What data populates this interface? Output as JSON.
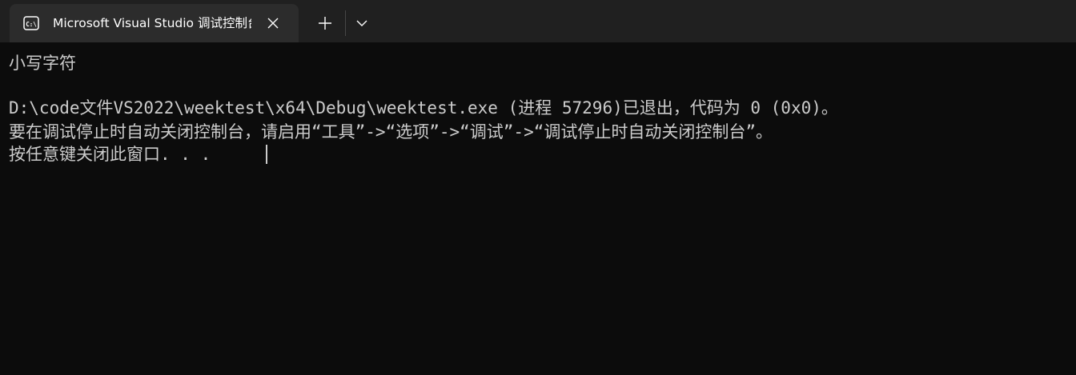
{
  "tab": {
    "title": "Microsoft Visual Studio 调试控制台",
    "icon": "console-icon"
  },
  "controls": {
    "new_tab_icon": "plus-icon",
    "dropdown_icon": "chevron-down-icon",
    "close_icon": "close-icon"
  },
  "console": {
    "lines": [
      "小写字符",
      "",
      "D:\\code文件VS2022\\weektest\\x64\\Debug\\weektest.exe (进程 57296)已退出，代码为 0 (0x0)。",
      "要在调试停止时自动关闭控制台，请启用“工具”->“选项”->“调试”->“调试停止时自动关闭控制台”。",
      "按任意键关闭此窗口. . ."
    ]
  },
  "colors": {
    "background": "#0c0c0c",
    "titlebar": "#202020",
    "active_tab": "#2c2c2c",
    "text": "#cccccc"
  }
}
